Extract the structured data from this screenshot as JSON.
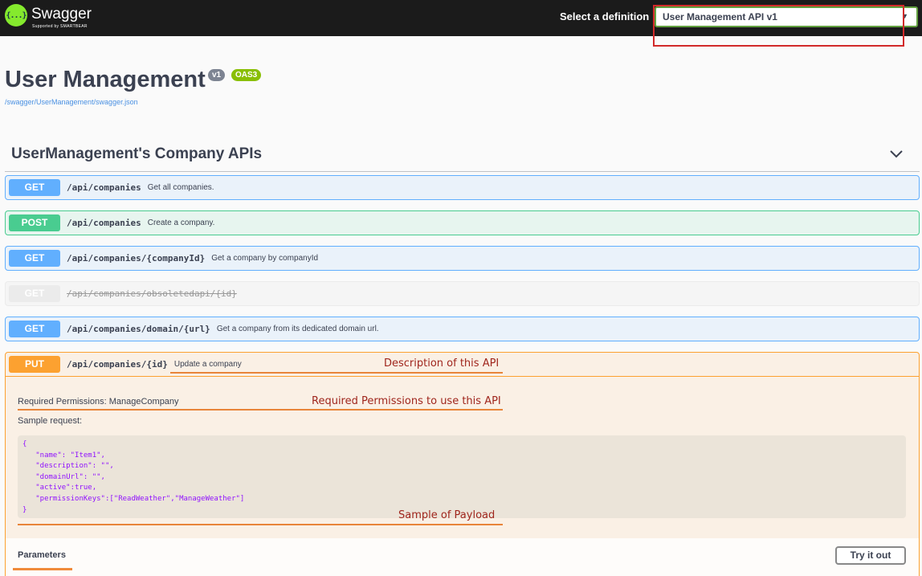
{
  "topbar": {
    "logo_glyph": "{...}",
    "brand": "Swagger",
    "brand_sub": "Supported by SMARTBEAR",
    "definition_label": "Select a definition",
    "definition_value": "User Management API v1"
  },
  "info": {
    "title": "User Management",
    "version_badge": "v1",
    "oas_badge": "OAS3",
    "spec_url": "/swagger/UserManagement/swagger.json"
  },
  "tag": {
    "title": "UserManagement's Company APIs"
  },
  "operations": [
    {
      "method": "GET",
      "path": "/api/companies",
      "summary": "Get all companies."
    },
    {
      "method": "POST",
      "path": "/api/companies",
      "summary": "Create a company."
    },
    {
      "method": "GET",
      "path": "/api/companies/{companyId}",
      "summary": "Get a company by companyId"
    },
    {
      "method": "GET",
      "path": "/api/companies/obsoletedapi/{id}",
      "summary": ""
    },
    {
      "method": "GET",
      "path": "/api/companies/domain/{url}",
      "summary": "Get a company from its dedicated domain url."
    },
    {
      "method": "PUT",
      "path": "/api/companies/{id}",
      "summary": "Update a company"
    }
  ],
  "put_details": {
    "required_permissions": "Required Permissions: ManageCompany",
    "sample_label": "Sample request:",
    "sample_code": "{\n   \"name\": \"Item1\",\n   \"description\": \"\",\n   \"domainUrl\": \"\",\n   \"active\":true,\n   \"permissionKeys\":[\"ReadWeather\",\"ManageWeather\"]\n}",
    "parameters_tab": "Parameters",
    "try_button": "Try it out"
  },
  "annotations": {
    "description": "Description of this API",
    "permissions": "Required Permissions to use this API",
    "payload": "Sample of Payload"
  },
  "colors": {
    "get": "#61affe",
    "post": "#49cc90",
    "put": "#fca130",
    "deprecated": "#ebebeb",
    "annotation_text": "#a0261d",
    "annotation_line": "#e8853a",
    "highlight_box": "#d22a2a"
  }
}
